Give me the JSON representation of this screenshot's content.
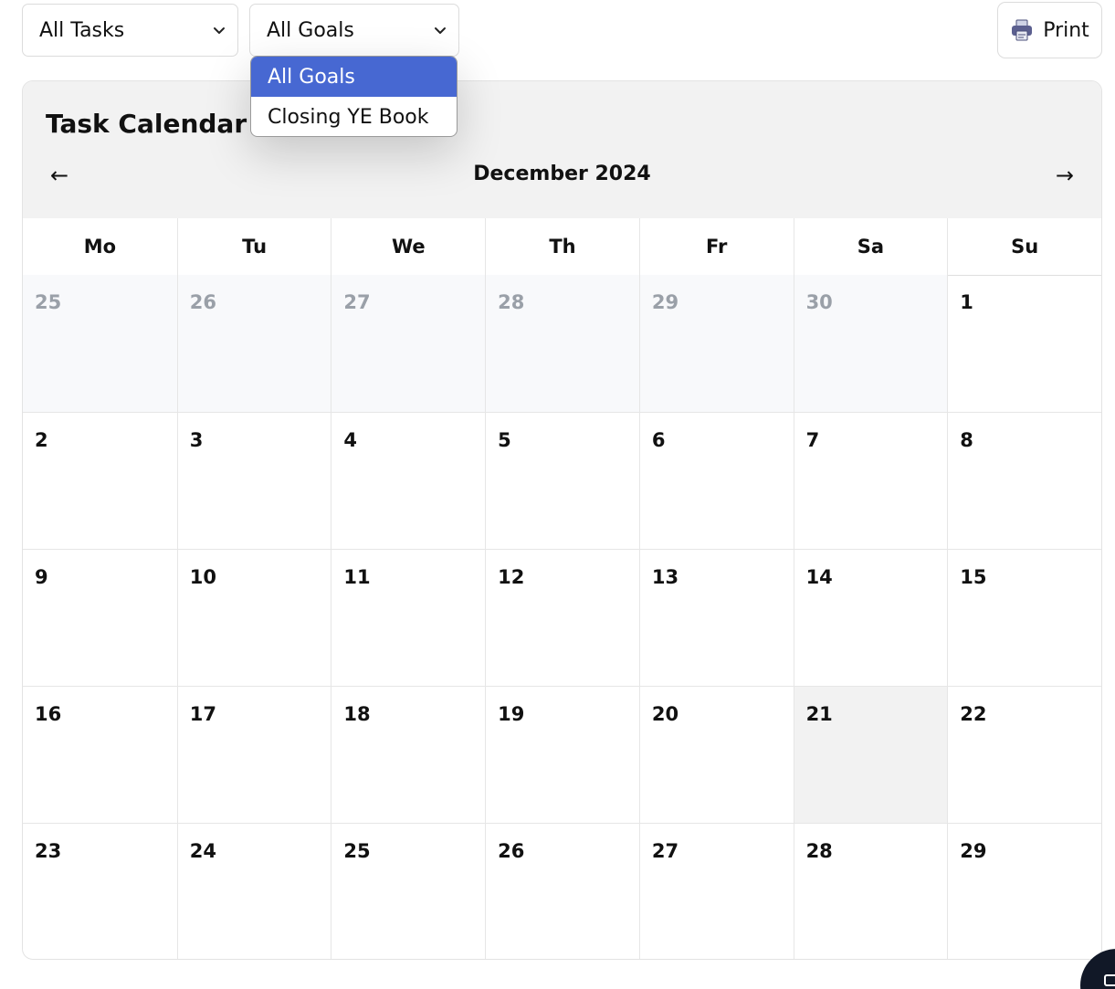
{
  "toolbar": {
    "tasks_filter": "All Tasks",
    "goals_filter": "All Goals",
    "print_label": "Print"
  },
  "dropdown": {
    "options": [
      "All Goals",
      "Closing YE Book"
    ],
    "selected": "All Goals"
  },
  "calendar": {
    "title": "Task Calendar",
    "month": "December 2024",
    "prev": "←",
    "next": "→",
    "weekdays": [
      "Mo",
      "Tu",
      "We",
      "Th",
      "Fr",
      "Sa",
      "Su"
    ],
    "weeks": [
      [
        "25",
        "26",
        "27",
        "28",
        "29",
        "30",
        "1"
      ],
      [
        "2",
        "3",
        "4",
        "5",
        "6",
        "7",
        "8"
      ],
      [
        "9",
        "10",
        "11",
        "12",
        "13",
        "14",
        "15"
      ],
      [
        "16",
        "17",
        "18",
        "19",
        "20",
        "21",
        "22"
      ],
      [
        "23",
        "24",
        "25",
        "26",
        "27",
        "28",
        "29"
      ]
    ],
    "other_month_days_first_week": 6,
    "today": "21"
  },
  "colors": {
    "accent": "#4768d2",
    "header_bg": "#f2f2f2",
    "muted_text": "#9aa0a8"
  },
  "icons": {
    "print": "printer-icon",
    "select": "chevron-down-icon",
    "chat": "chat-icon"
  }
}
